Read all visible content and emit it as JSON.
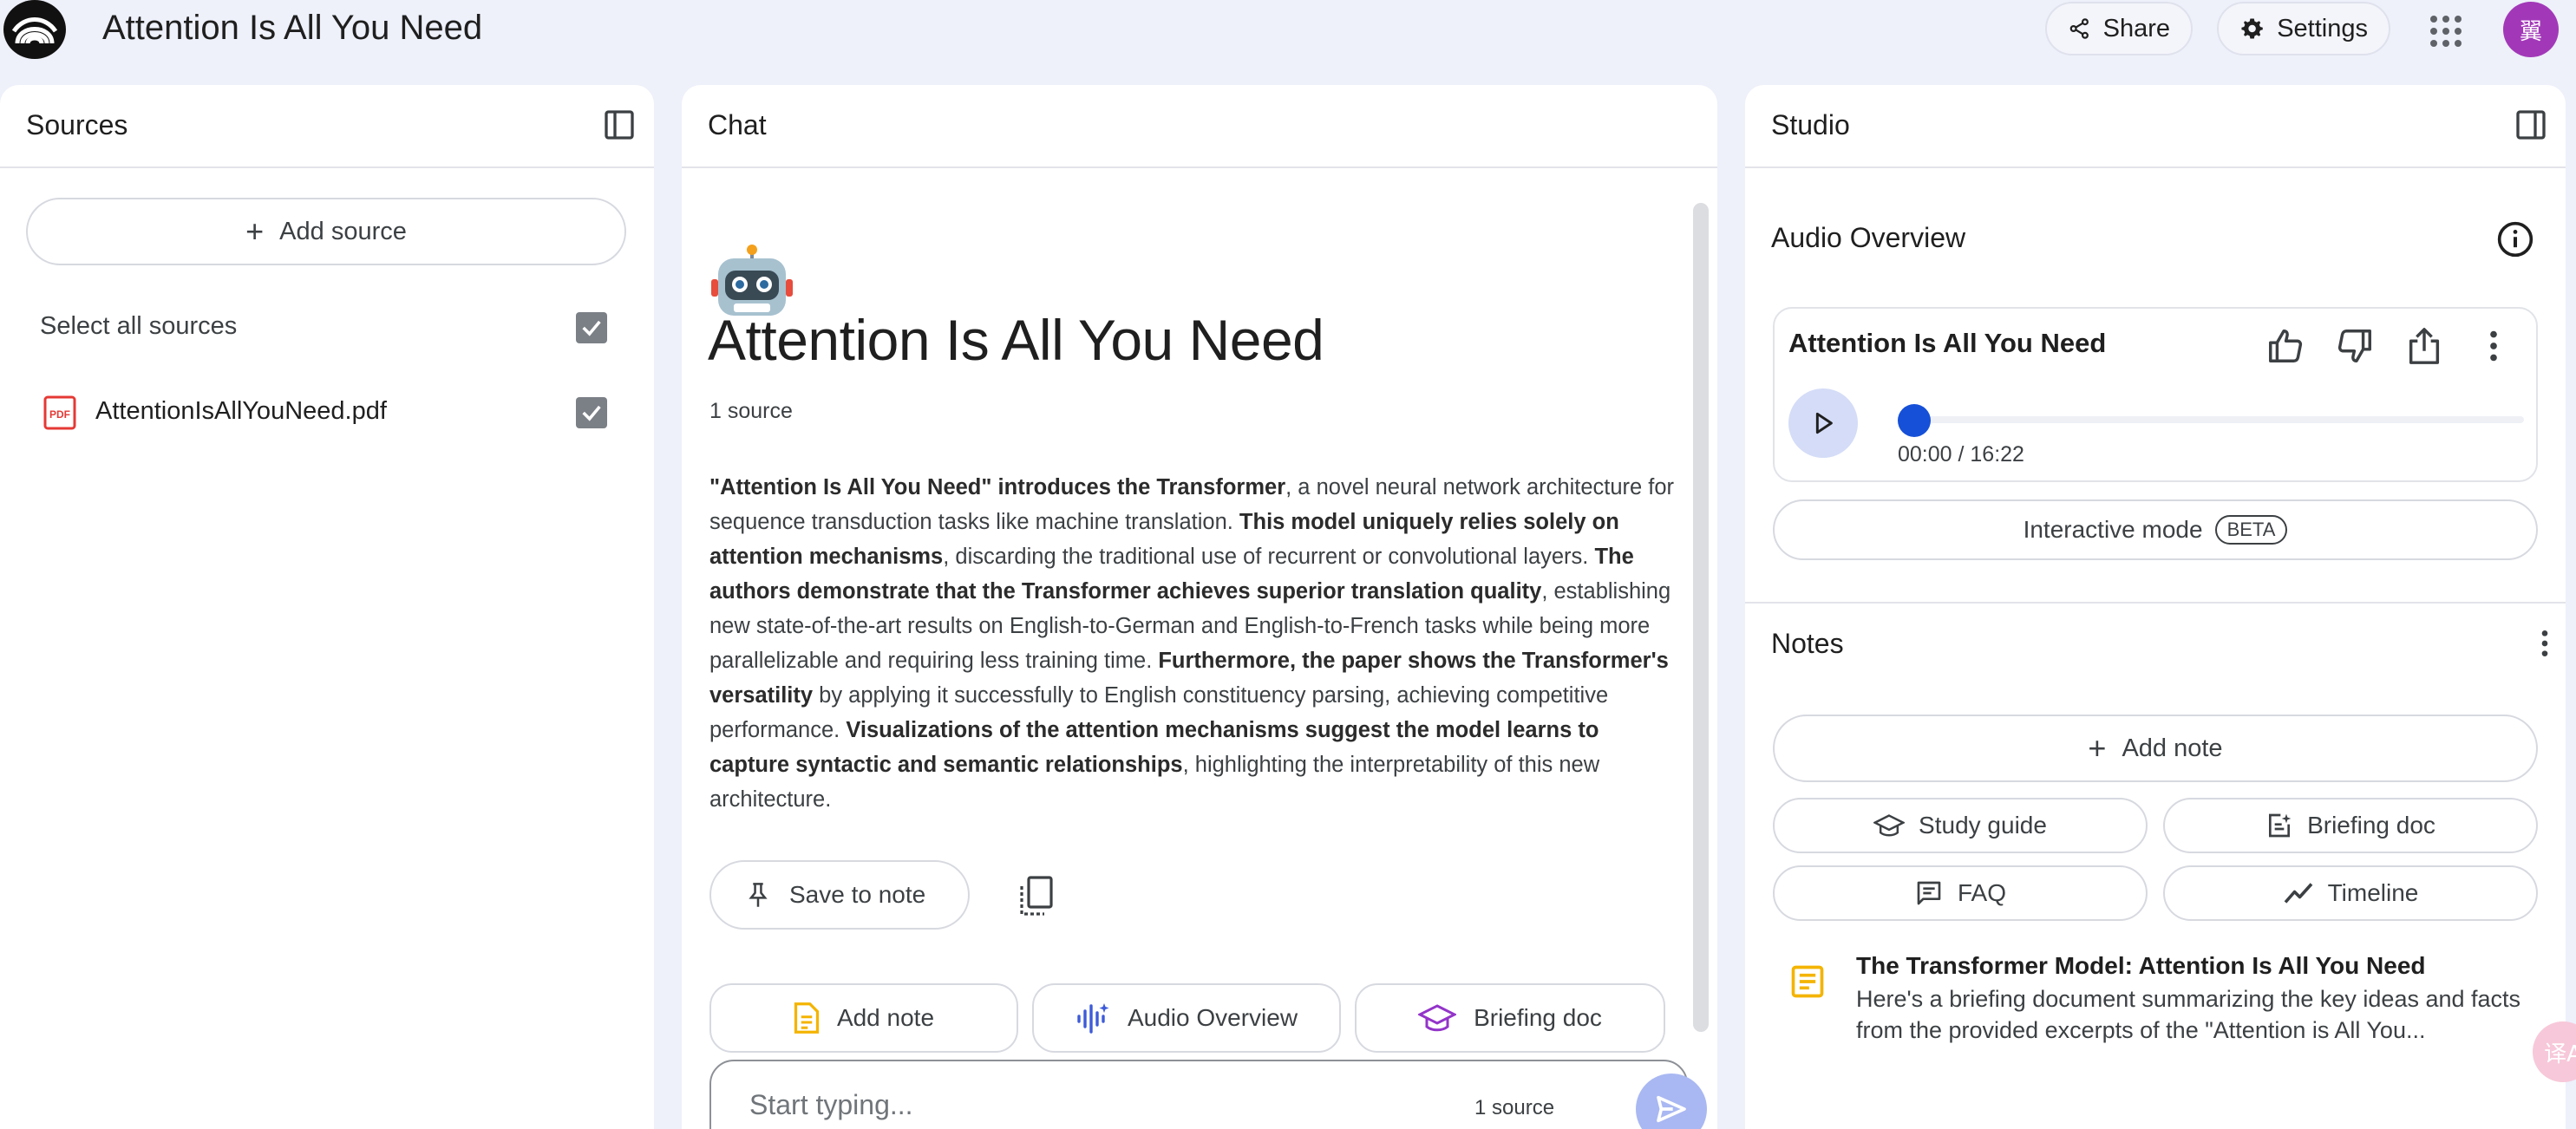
{
  "header": {
    "title": "Attention Is All You Need",
    "share_label": "Share",
    "settings_label": "Settings",
    "avatar_initial": "翼"
  },
  "sources": {
    "title": "Sources",
    "add_source_label": "Add source",
    "select_all_label": "Select all sources",
    "items": [
      {
        "name": "AttentionIsAllYouNeed.pdf",
        "checked": true
      }
    ]
  },
  "chat": {
    "title": "Chat",
    "heading": "Attention Is All You Need",
    "source_count": "1 source",
    "summary": [
      {
        "t": "\"Attention Is All You Need\" introduces the Transformer",
        "b": true
      },
      {
        "t": ", a novel neural network architecture for sequence transduction tasks like machine translation. ",
        "b": false
      },
      {
        "t": "This model uniquely relies solely on attention mechanisms",
        "b": true
      },
      {
        "t": ", discarding the traditional use of recurrent or convolutional layers. ",
        "b": false
      },
      {
        "t": "The authors demonstrate that the Transformer achieves superior translation quality",
        "b": true
      },
      {
        "t": ", establishing new state-of-the-art results on English-to-German and English-to-French tasks while being more parallelizable and requiring less training time. ",
        "b": false
      },
      {
        "t": "Furthermore, the paper shows the Transformer's versatility",
        "b": true
      },
      {
        "t": " by applying it successfully to English constituency parsing, achieving competitive performance. ",
        "b": false
      },
      {
        "t": "Visualizations of the attention mechanisms suggest the model learns to capture syntactic and semantic relationships",
        "b": true
      },
      {
        "t": ", highlighting the interpretability of this new architecture.",
        "b": false
      }
    ],
    "save_to_note_label": "Save to note",
    "chips": {
      "add_note": "Add note",
      "audio_overview": "Audio Overview",
      "briefing_doc": "Briefing doc"
    },
    "input_placeholder": "Start typing...",
    "input_source_count": "1 source"
  },
  "studio": {
    "title": "Studio",
    "audio_overview_title": "Audio Overview",
    "audio_card": {
      "title": "Attention Is All You Need",
      "time": "00:00 / 16:22",
      "progress": 0.0
    },
    "interactive_mode_label": "Interactive mode",
    "beta_label": "BETA",
    "notes_title": "Notes",
    "add_note_label": "Add note",
    "note_chips": {
      "study_guide": "Study guide",
      "briefing_doc": "Briefing doc",
      "faq": "FAQ",
      "timeline": "Timeline"
    },
    "note": {
      "title": "The Transformer Model: Attention Is All You Need",
      "snippet": "Here's a briefing document summarizing the key ideas and facts from the provided excerpts of the \"Attention is All You..."
    }
  },
  "floating": {
    "translate_glyph": "译A"
  },
  "colors": {
    "background": "#eef0fa",
    "accent_blue": "#1650d8",
    "avatar": "#a238b8",
    "note_yellow": "#f4b400"
  }
}
